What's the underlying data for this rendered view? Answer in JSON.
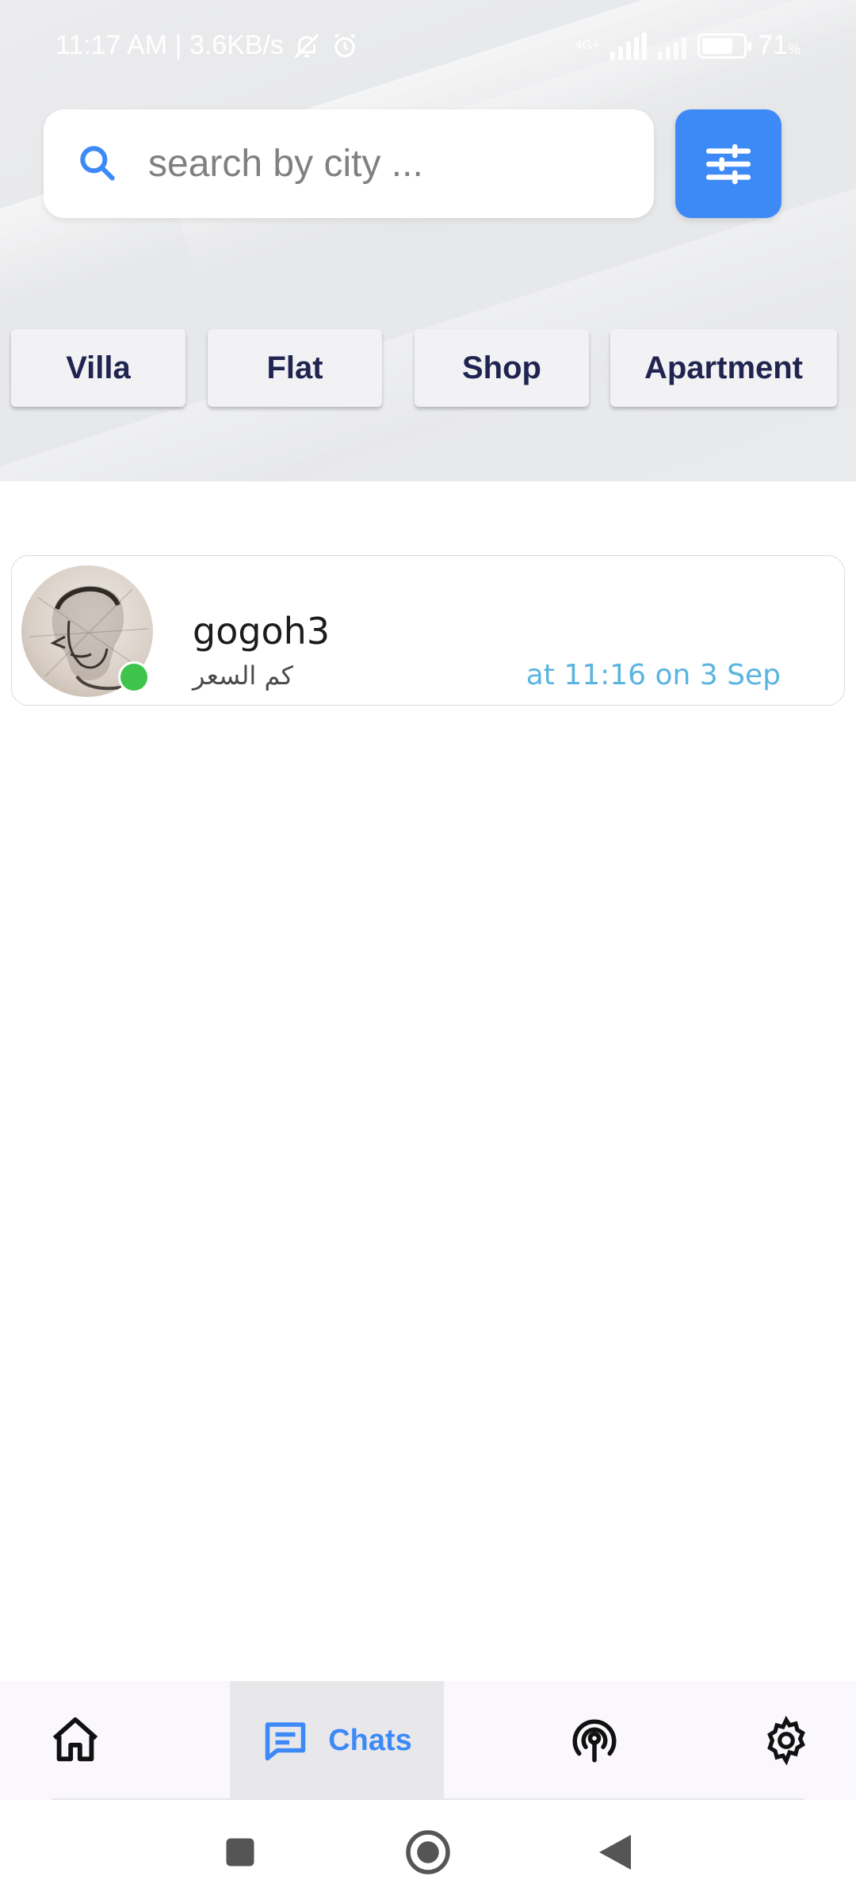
{
  "status_bar": {
    "time": "11:17 AM | 3.6KB/s",
    "network": "4G+",
    "battery": "71",
    "battery_unit": "%"
  },
  "search": {
    "placeholder": "search by city ..."
  },
  "categories": [
    "Villa",
    "Flat",
    "Shop",
    "Apartment"
  ],
  "chats": [
    {
      "name": "gogoh3",
      "last_message": "كم السعر",
      "time": "at 11:16 on 3 Sep",
      "online": true
    }
  ],
  "bottom_nav": {
    "items": [
      {
        "icon": "home-icon",
        "label": ""
      },
      {
        "icon": "chat-icon",
        "label": "Chats",
        "active": true
      },
      {
        "icon": "broadcast-icon",
        "label": ""
      },
      {
        "icon": "settings-icon",
        "label": ""
      }
    ]
  },
  "colors": {
    "accent": "#3d8af7",
    "chip_text": "#1f2550",
    "online": "#3ec44a",
    "time_text": "#5ab4e0"
  }
}
